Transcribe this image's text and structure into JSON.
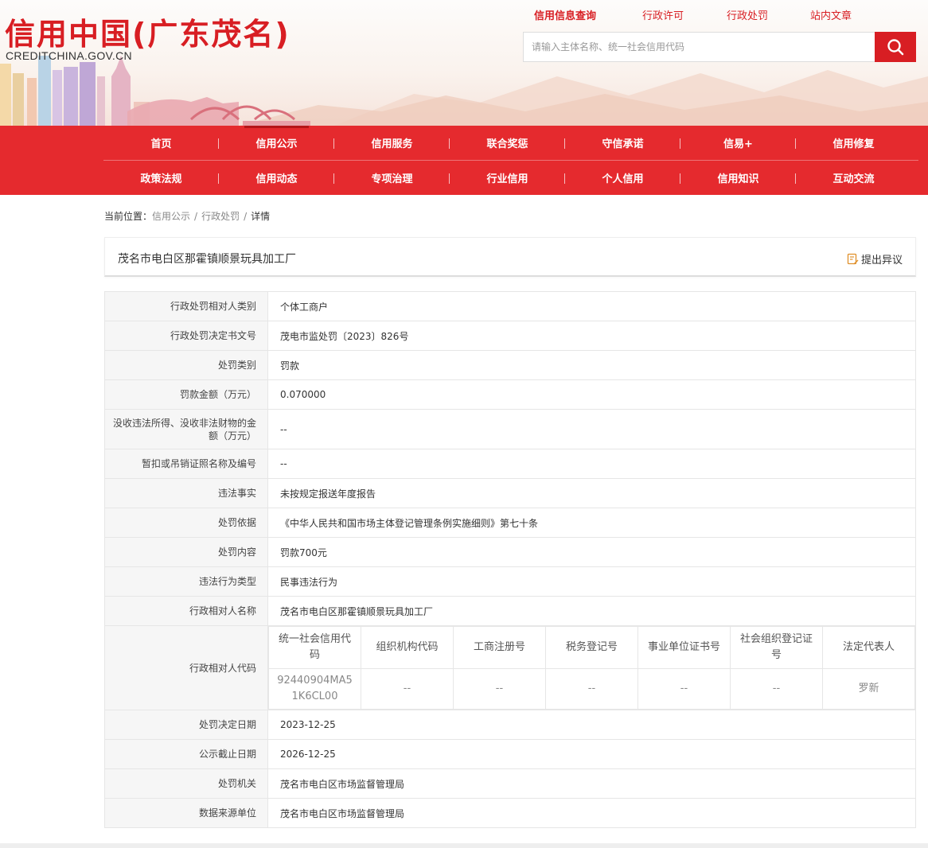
{
  "site": {
    "logo_cn": "信用中国(广东茂名)",
    "logo_en": "CREDITCHINA.GOV.CN"
  },
  "top_links": [
    {
      "label": "信用信息查询",
      "active": true
    },
    {
      "label": "行政许可",
      "active": false
    },
    {
      "label": "行政处罚",
      "active": false
    },
    {
      "label": "站内文章",
      "active": false
    }
  ],
  "search": {
    "placeholder": "请输入主体名称、统一社会信用代码",
    "icon": "search-icon"
  },
  "nav": {
    "row1": [
      "首页",
      "信用公示",
      "信用服务",
      "联合奖惩",
      "守信承诺",
      "信易+",
      "信用修复"
    ],
    "row2": [
      "政策法规",
      "信用动态",
      "专项治理",
      "行业信用",
      "个人信用",
      "信用知识",
      "互动交流"
    ],
    "active": "信用公示"
  },
  "breadcrumb": {
    "prefix": "当前位置：",
    "items": [
      "信用公示",
      "行政处罚",
      "详情"
    ]
  },
  "entity": {
    "name": "茂名市电白区那霍镇顺景玩具加工厂",
    "objection_label": "提出异议",
    "objection_icon": "edit-icon"
  },
  "details": {
    "rows_top": [
      {
        "label": "行政处罚相对人类别",
        "value": "个体工商户"
      },
      {
        "label": "行政处罚决定书文号",
        "value": "茂电市监处罚〔2023〕826号"
      },
      {
        "label": "处罚类别",
        "value": "罚款"
      },
      {
        "label": "罚款金额（万元）",
        "value": "0.070000"
      },
      {
        "label": "没收违法所得、没收非法财物的金额（万元）",
        "value": "--"
      },
      {
        "label": "暂扣或吊销证照名称及编号",
        "value": "--"
      },
      {
        "label": "违法事实",
        "value": "未按规定报送年度报告"
      },
      {
        "label": "处罚依据",
        "value": "《中华人民共和国市场主体登记管理条例实施细则》第七十条"
      },
      {
        "label": "处罚内容",
        "value": "罚款700元"
      },
      {
        "label": "违法行为类型",
        "value": "民事违法行为"
      },
      {
        "label": "行政相对人名称",
        "value": "茂名市电白区那霍镇顺景玩具加工厂"
      }
    ],
    "codes": {
      "label": "行政相对人代码",
      "headers": [
        "统一社会信用代码",
        "组织机构代码",
        "工商注册号",
        "税务登记号",
        "事业单位证书号",
        "社会组织登记证号",
        "法定代表人"
      ],
      "values": [
        "92440904MA51K6CL00",
        "--",
        "--",
        "--",
        "--",
        "--",
        "罗新"
      ]
    },
    "rows_bottom": [
      {
        "label": "处罚决定日期",
        "value": "2023-12-25"
      },
      {
        "label": "公示截止日期",
        "value": "2026-12-25"
      },
      {
        "label": "处罚机关",
        "value": "茂名市电白区市场监督管理局"
      },
      {
        "label": "数据来源单位",
        "value": "茂名市电白区市场监督管理局"
      }
    ]
  },
  "colors": {
    "brand_red": "#d81e23",
    "nav_red": "#e52a2e"
  }
}
